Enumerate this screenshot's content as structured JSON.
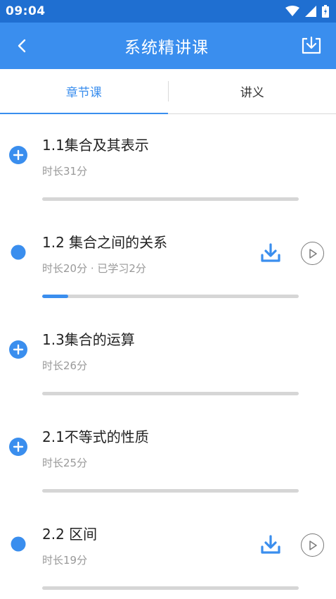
{
  "status_bar": {
    "time": "09:04"
  },
  "app_bar": {
    "title": "系统精讲课"
  },
  "tabs": [
    {
      "label": "章节课",
      "active": true
    },
    {
      "label": "讲义",
      "active": false
    }
  ],
  "lessons": [
    {
      "title": "1.1集合及其表示",
      "meta": "时长31分",
      "progress": 0,
      "state": "add"
    },
    {
      "title": "1.2 集合之间的关系",
      "meta": "时长20分 · 已学习2分",
      "progress": 0.1,
      "state": "downloaded"
    },
    {
      "title": "1.3集合的运算",
      "meta": "时长26分",
      "progress": 0,
      "state": "add"
    },
    {
      "title": "2.1不等式的性质",
      "meta": "时长25分",
      "progress": 0,
      "state": "add"
    },
    {
      "title": "2.2 区间",
      "meta": "时长19分",
      "progress": 0,
      "state": "downloaded"
    }
  ],
  "colors": {
    "accent": "#3a8eee",
    "status_bar": "#1f6fd1",
    "track": "#d6d6d6"
  }
}
